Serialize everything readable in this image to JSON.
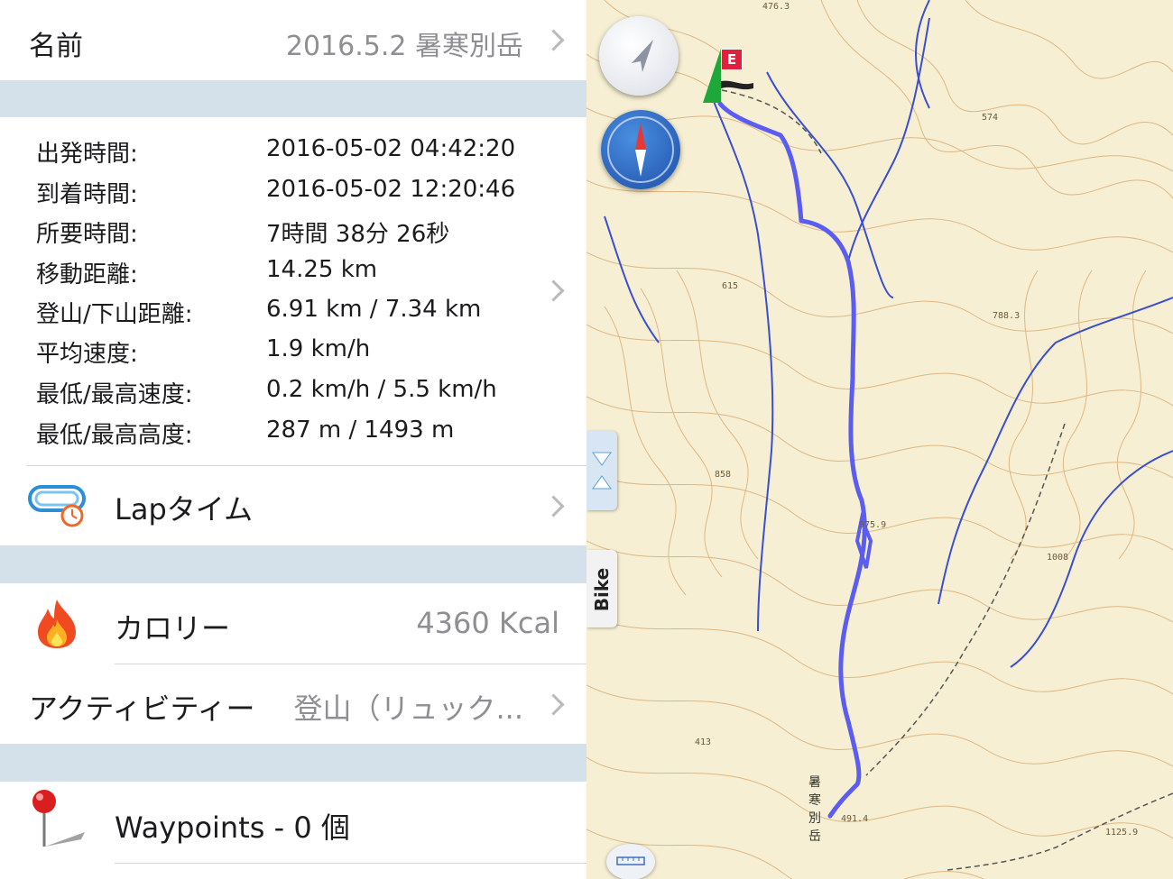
{
  "name_row": {
    "label": "名前",
    "value": "2016.5.2 暑寒別岳"
  },
  "stats": [
    {
      "label": "出発時間:",
      "value": "2016-05-02 04:42:20"
    },
    {
      "label": "到着時間:",
      "value": "2016-05-02 12:20:46"
    },
    {
      "label": "所要時間:",
      "value": "7時間 38分 26秒"
    },
    {
      "label": "移動距離:",
      "value": "14.25 km"
    },
    {
      "label": "登山/下山距離:",
      "value": "6.91 km / 7.34 km"
    },
    {
      "label": "平均速度:",
      "value": "1.9 km/h"
    },
    {
      "label": "最低/最高速度:",
      "value": "0.2 km/h / 5.5 km/h"
    },
    {
      "label": "最低/最高高度:",
      "value": "287 m / 1493 m"
    }
  ],
  "lap": {
    "label": "Lapタイム"
  },
  "calorie": {
    "label": "カロリー",
    "value": "4360 Kcal"
  },
  "activity": {
    "label": "アクティビティー",
    "value": "登山（リュック..."
  },
  "waypoints": {
    "label": "Waypoints - 0 個"
  },
  "map": {
    "end_marker": "E",
    "bike_tab": "Bike",
    "track_color": "#5b5cf0",
    "elevation_labels": [
      "476.3",
      "574",
      "615",
      "788.3",
      "858",
      "975.9",
      "1008",
      "413",
      "491.4",
      "1125.9"
    ],
    "place_name": [
      "暑",
      "寒",
      "別",
      "岳"
    ]
  }
}
